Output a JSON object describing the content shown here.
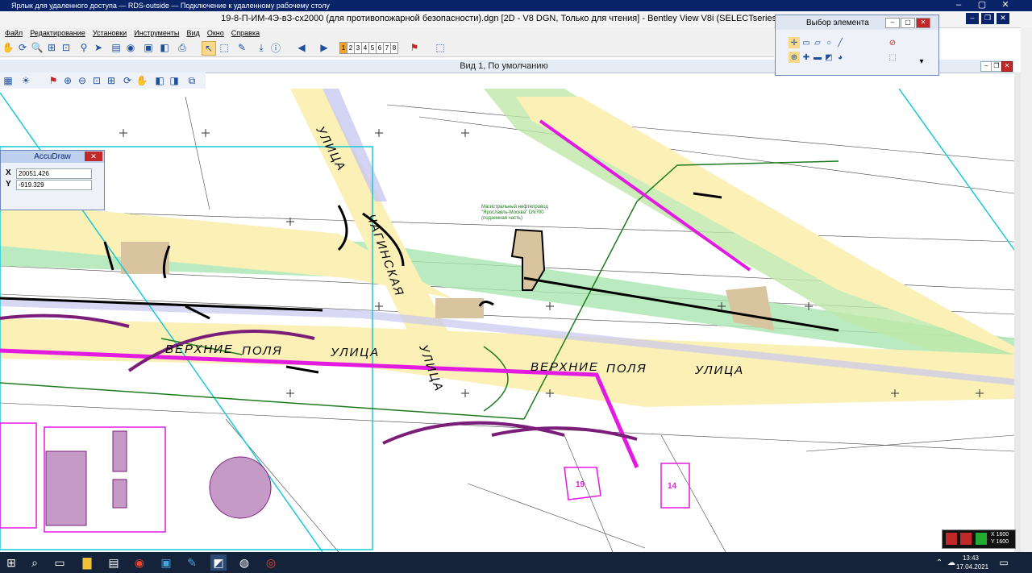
{
  "rds": {
    "title": "Ярлык для удаленного доступа — RDS-outside — Подключение к удаленному рабочему столу"
  },
  "app": {
    "title": "19-8-П-ИМ-4Э-вЗ-сх2000 (для противопожарной безопасности).dgn [2D - V8 DGN, Только для чтения] - Bentley View V8i (SELECTseries 3)"
  },
  "menu": [
    "Файл",
    "Редактирование",
    "Установки",
    "Инструменты",
    "Вид",
    "Окно",
    "Справка"
  ],
  "toolbar": {
    "view_numbers": [
      "1",
      "2",
      "3",
      "4",
      "5",
      "6",
      "7",
      "8"
    ],
    "active_view": "1"
  },
  "view": {
    "title": "Вид 1, По умолчанию"
  },
  "accudraw": {
    "title": "AccuDraw",
    "x_label": "X",
    "y_label": "Y",
    "x_value": "20051.426",
    "y_value": "-919.329"
  },
  "element_selection": {
    "title": "Выбор элемента"
  },
  "drawing": {
    "street_labels": [
      "УЛИЦА",
      "ЧАГИНСКАЯ",
      "УЛИЦА",
      "ВЕРХНИЕ",
      "ПОЛЯ",
      "УЛИЦА",
      "ВЕРХНИЕ",
      "ПОЛЯ",
      "УЛИЦА"
    ],
    "lot_numbers": [
      "19",
      "14"
    ],
    "pipeline_note": [
      "Магистральный нефтепровод",
      "\"Ярославль-Москва\" DN700",
      "(подземная часть)"
    ]
  },
  "status": {
    "x_scale": "X 1600",
    "y_scale": "Y 1600"
  },
  "taskbar": {
    "time": "13:43",
    "date": "17.04.2021"
  }
}
